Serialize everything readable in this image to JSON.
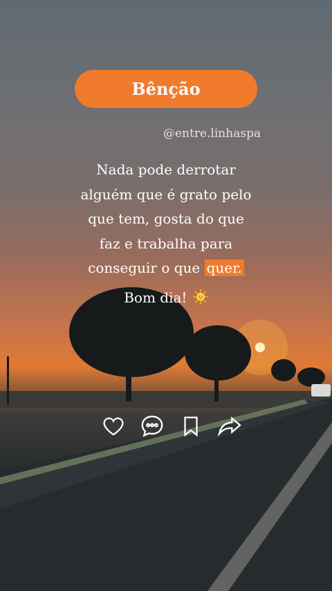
{
  "post": {
    "title": "Bênção",
    "handle": "@entre.linhaspa",
    "quote_lines": [
      "Nada pode derrotar",
      "alguém que é grato pelo",
      "que tem, gosta do que",
      "faz e trabalha para",
      "conseguir o que"
    ],
    "highlight_word": "quer.",
    "greeting": "Bom dia!"
  },
  "actions": [
    {
      "name": "like",
      "icon": "heart-icon"
    },
    {
      "name": "comment",
      "icon": "comment-icon"
    },
    {
      "name": "save",
      "icon": "bookmark-icon"
    },
    {
      "name": "share",
      "icon": "share-arrow-icon"
    }
  ],
  "colors": {
    "accent": "#f07b2c",
    "text": "#ffffff"
  }
}
